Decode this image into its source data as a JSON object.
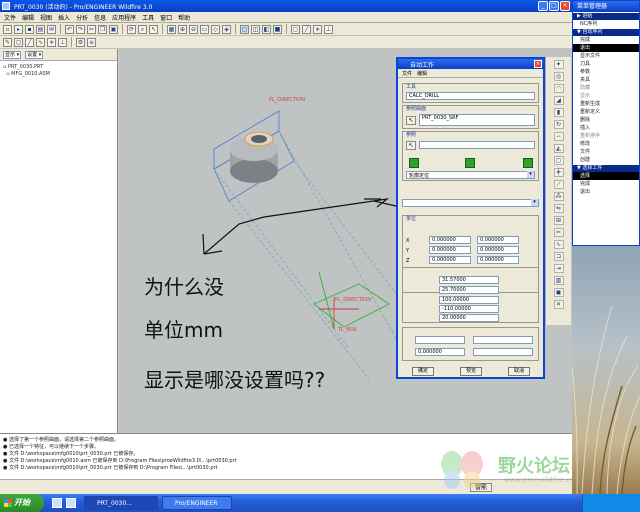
{
  "app": {
    "title": "PRT_0030 (活动的) - Pro/ENGINEER Wildfire 3.0"
  },
  "menubar": [
    "文件",
    "编辑",
    "视图",
    "插入",
    "分析",
    "信息",
    "应用程序",
    "工具",
    "窗口",
    "帮助"
  ],
  "model_tree": {
    "show_label": "显示",
    "settings_label": "设置",
    "items": [
      "PRT_0030.PRT",
      "MFG_0010.ASM"
    ]
  },
  "viewport": {
    "label_top": "PL_DIRECTION",
    "label_bottom": "PL_DIRECTION",
    "axis_label": "TL_BOX"
  },
  "dialog": {
    "title": "自动工作",
    "menu": [
      "文件",
      "编辑"
    ],
    "tool_label": "工具",
    "tool_value": "CALC_DRILL",
    "ref_label": "参照曲面",
    "ref_value": "PRT_0030_SRF",
    "combo_value": "轮廓定位",
    "ref_small": "参照",
    "unit_label": "单位",
    "fields": [
      "0.000000",
      "0.000000",
      "0.000000",
      "0.000000",
      "0.000000",
      "0.000000"
    ],
    "values": {
      "v1": "31.57000",
      "v2": "25.70000",
      "v3": "100.00000",
      "v4": "-110.00000",
      "v5": "20.00000",
      "v6": "0.000000"
    },
    "btn_ok": "确定",
    "btn_preview": "预览",
    "btn_cancel": "取消"
  },
  "menu_manager": {
    "title": "菜单管理器",
    "section1": "▶ 进给",
    "opt1": "NC序列",
    "section2": "▼ 自动序列",
    "items": [
      "完成",
      "退出",
      "显示文件",
      "刀具",
      "参数",
      "夹具",
      "隐藏",
      "显示",
      "重新生成",
      "重新定义",
      "删除",
      "插入",
      "重新排序",
      "修改",
      "文件",
      "创建"
    ],
    "section3": "▼ 选择工件",
    "sub_items": [
      "选择",
      "完成",
      "退出"
    ]
  },
  "messages": [
    "● 选择了第一个参照曲面，请选择第二个参照曲面。",
    "● 已选择一个特征，可以继续下一个步骤。",
    "● 文件 D:\\workspace\\mfg0010\\prt_0030.prt 已被保存。",
    "● 文件 D:\\workspace\\mfg0010.asm 已被保存到 D:\\Program Files\\proeWildfire3.0\\...\\prt0030.prt",
    "● 文件 D:\\workspace\\mfg0010\\prt_0030.prt 已被保存到 D:\\Program Files\\...\\prt0030.prt"
  ],
  "status": {
    "button": "智能"
  },
  "annotation": {
    "line1": "为什么没",
    "line2": "单位mm",
    "line3": "显示是哪没设置吗??"
  },
  "watermark": {
    "text": "野火论坛",
    "url": "www.proewildfire.cn"
  },
  "taskbar": {
    "start": "开始",
    "tasks": [
      "PRT_0030...",
      "Pro/ENGINEER"
    ],
    "clock": ""
  }
}
